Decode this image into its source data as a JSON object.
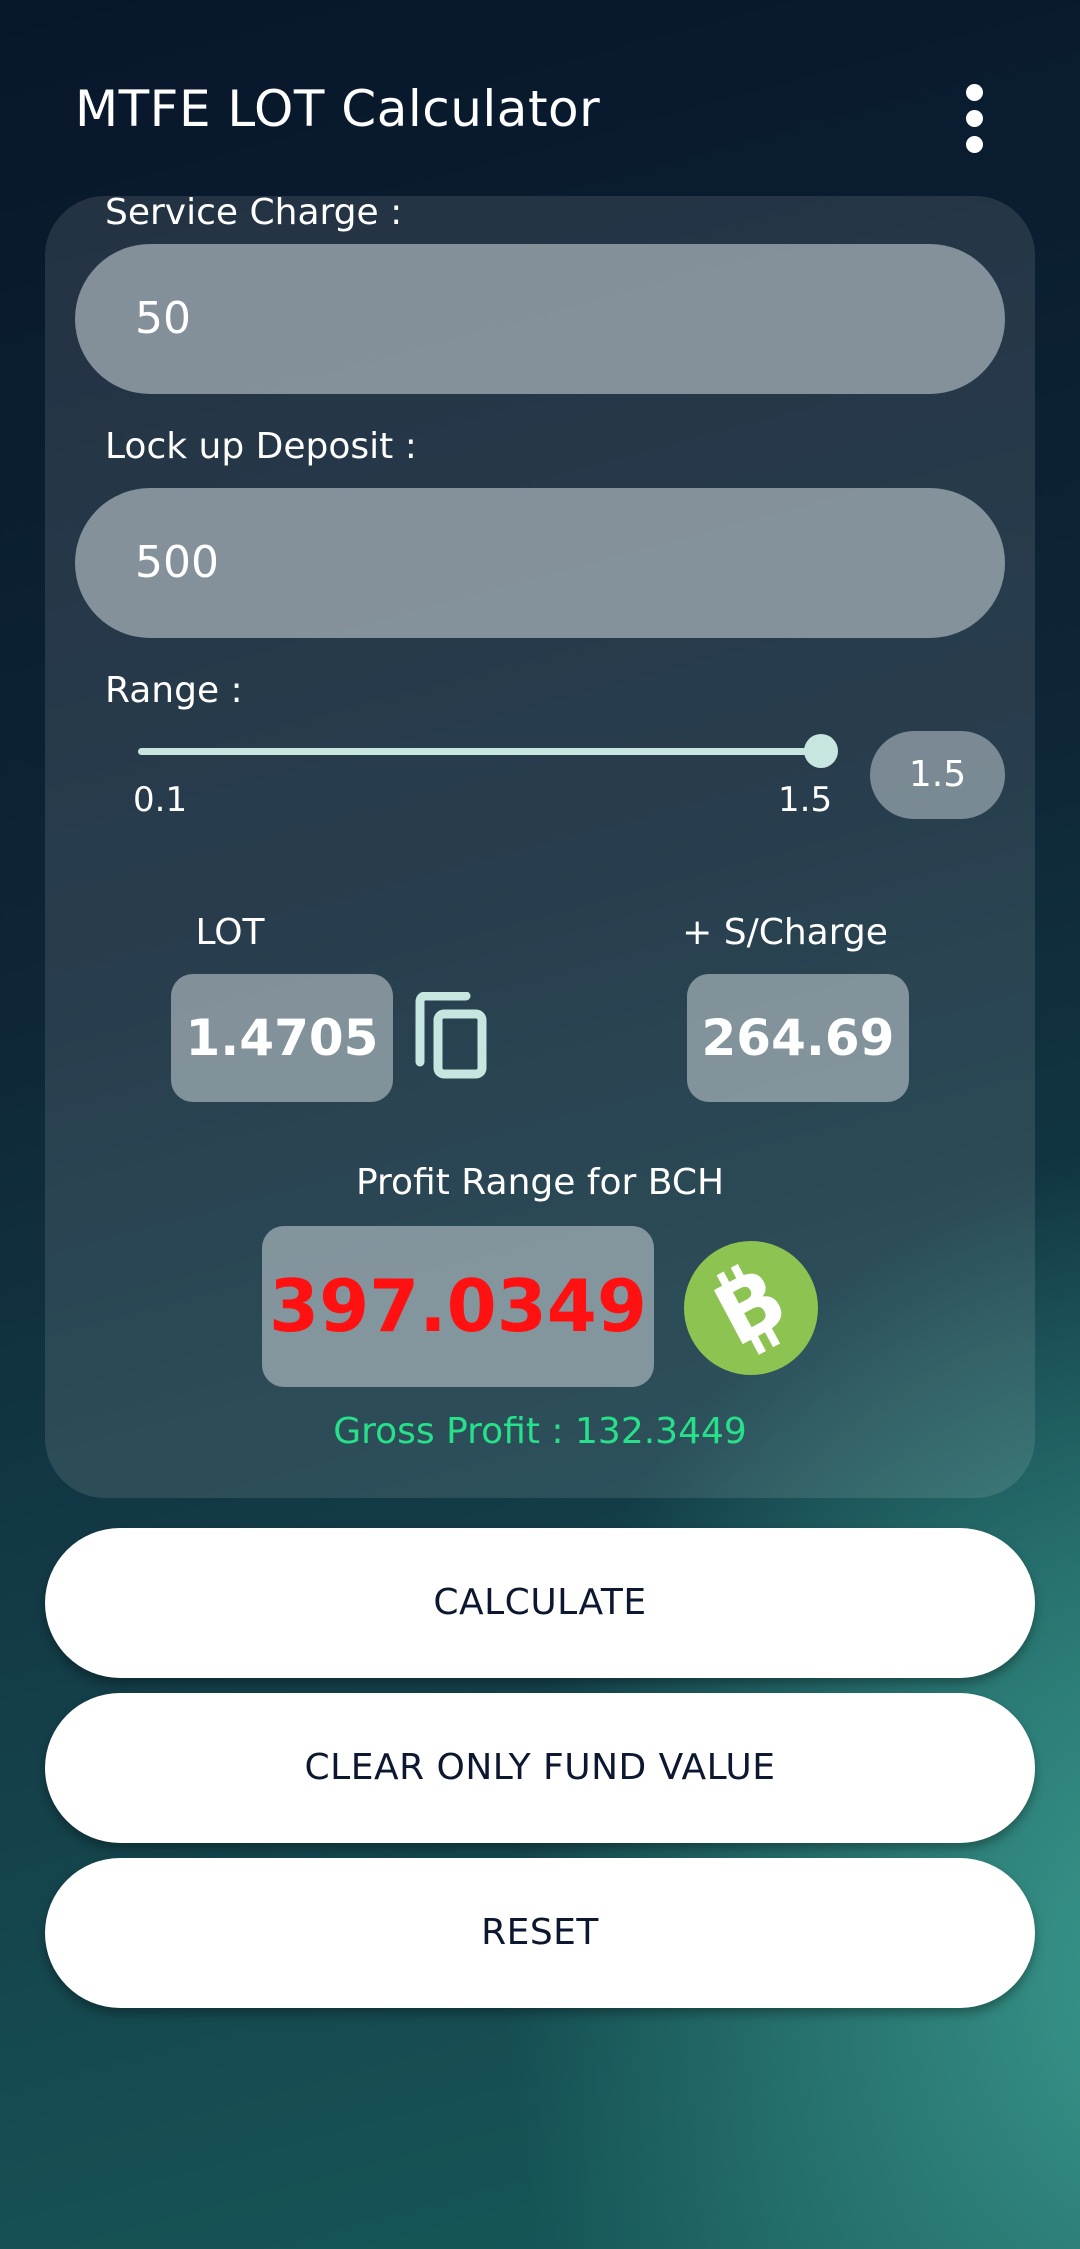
{
  "app": {
    "title": "MTFE LOT Calculator",
    "menu_icon": "more-vert-icon"
  },
  "form": {
    "service_charge": {
      "label": "Service Charge :",
      "value": "50"
    },
    "lock_up_deposit": {
      "label": "Lock up Deposit :",
      "value": "500"
    },
    "range": {
      "label": "Range :",
      "min_label": "0.1",
      "max_label": "1.5",
      "min": 0.1,
      "max": 1.5,
      "value": 1.5,
      "value_label": "1.5",
      "color": "#c7e6df"
    }
  },
  "results": {
    "lot": {
      "label": "LOT",
      "value": "1.4705",
      "copy_icon": "copy-icon"
    },
    "s_charge": {
      "label": "+ S/Charge",
      "value": "264.69"
    },
    "profit": {
      "label": "Profit Range for BCH",
      "value": "397.0349",
      "value_color": "#ff1111",
      "coin_icon": "bitcoin-cash-icon",
      "coin_color": "#8dc351"
    },
    "gross_profit": "Gross Profit : 132.3449",
    "gross_profit_color": "#27e08a"
  },
  "buttons": {
    "calculate": "CALCULATE",
    "clear_fund": "CLEAR ONLY FUND VALUE",
    "reset": "RESET"
  }
}
